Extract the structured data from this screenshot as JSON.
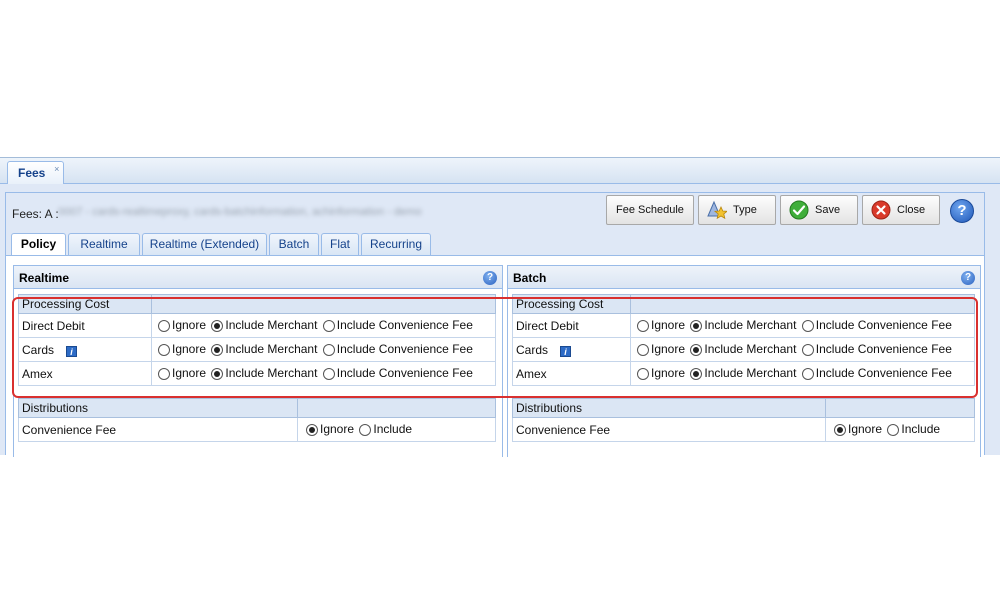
{
  "window": {
    "tab_title": "Fees",
    "tab_close": "×"
  },
  "toolbar": {
    "fees_label": "Fees: A :",
    "fees_value_redacted": "0007 - cards-realtimeproxy, cards-batchinformation, achinformation - demo",
    "fee_schedule_label": "Fee Schedule",
    "type_label": "Type",
    "save_label": "Save",
    "close_label": "Close",
    "help_glyph": "?"
  },
  "tabs": [
    {
      "label": "Policy",
      "active": true
    },
    {
      "label": "Realtime",
      "active": false
    },
    {
      "label": "Realtime (Extended)",
      "active": false
    },
    {
      "label": "Batch",
      "active": false
    },
    {
      "label": "Flat",
      "active": false
    },
    {
      "label": "Recurring",
      "active": false
    }
  ],
  "sections": [
    {
      "title": "Realtime",
      "processing_header": "Processing Cost",
      "rows": [
        {
          "label": "Direct Debit",
          "info": false,
          "selected": "Include Merchant"
        },
        {
          "label": "Cards",
          "info": true,
          "selected": "Include Merchant"
        },
        {
          "label": "Amex",
          "info": false,
          "selected": "Include Merchant"
        }
      ],
      "distributions_header": "Distributions",
      "distribution_rows": [
        {
          "label": "Convenience Fee",
          "selected": "Ignore"
        }
      ]
    },
    {
      "title": "Batch",
      "processing_header": "Processing Cost",
      "rows": [
        {
          "label": "Direct Debit",
          "info": false,
          "selected": "Include Merchant"
        },
        {
          "label": "Cards",
          "info": true,
          "selected": "Include Merchant"
        },
        {
          "label": "Amex",
          "info": false,
          "selected": "Include Merchant"
        }
      ],
      "distributions_header": "Distributions",
      "distribution_rows": [
        {
          "label": "Convenience Fee",
          "selected": "Ignore"
        }
      ]
    }
  ],
  "options": {
    "ignore": "Ignore",
    "include_merchant": "Include Merchant",
    "include_convenience_fee": "Include Convenience Fee",
    "include": "Include"
  },
  "info_glyph": "i",
  "colors": {
    "accent_blue": "#15428b",
    "panel_bg": "#dfe8f6",
    "border_blue": "#99bbe8",
    "highlight_red": "#d9302f"
  }
}
